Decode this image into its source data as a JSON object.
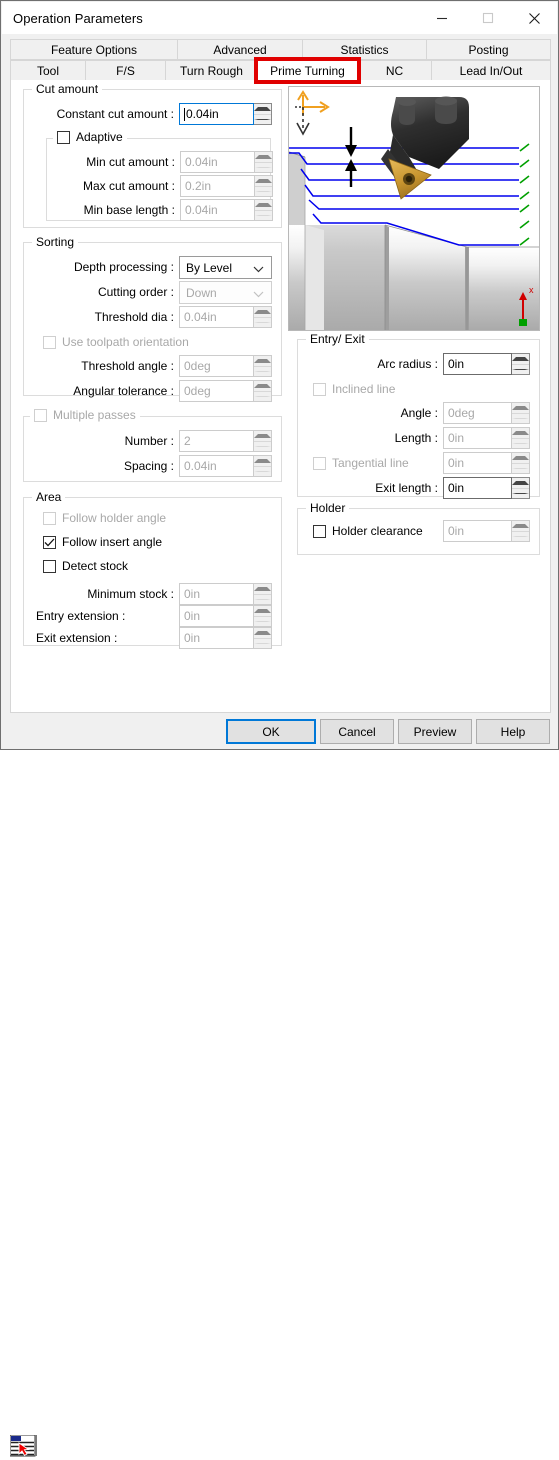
{
  "window": {
    "title": "Operation Parameters",
    "controls": {
      "minimize": "minimize-icon",
      "maximize": "maximize-icon",
      "close": "close-icon"
    }
  },
  "tabs": {
    "row1": [
      "Feature Options",
      "Advanced",
      "Statistics",
      "Posting"
    ],
    "row2": [
      "Tool",
      "F/S",
      "Turn Rough",
      "Prime Turning",
      "NC",
      "Lead In/Out"
    ],
    "active": "Prime Turning",
    "highlight_color": "#e00000"
  },
  "cut_amount": {
    "title": "Cut amount",
    "constant_cut_amount_label": "Constant cut amount :",
    "constant_cut_amount_value": "0.04in",
    "adaptive_label": "Adaptive",
    "adaptive_checked": false,
    "min_cut_amount_label": "Min cut amount :",
    "min_cut_amount_value": "0.04in",
    "max_cut_amount_label": "Max cut amount :",
    "max_cut_amount_value": "0.2in",
    "min_base_length_label": "Min base length :",
    "min_base_length_value": "0.04in"
  },
  "sorting": {
    "title": "Sorting",
    "depth_processing_label": "Depth processing :",
    "depth_processing_value": "By Level",
    "cutting_order_label": "Cutting order :",
    "cutting_order_value": "Down",
    "threshold_dia_label": "Threshold dia :",
    "threshold_dia_value": "0.04in",
    "use_toolpath_orientation_label": "Use toolpath orientation",
    "use_toolpath_orientation_checked": false,
    "threshold_angle_label": "Threshold angle :",
    "threshold_angle_value": "0deg",
    "angular_tolerance_label": "Angular tolerance :",
    "angular_tolerance_value": "0deg"
  },
  "multiple_passes": {
    "title": "Multiple passes",
    "checked": false,
    "number_label": "Number :",
    "number_value": "2",
    "spacing_label": "Spacing :",
    "spacing_value": "0.04in"
  },
  "area": {
    "title": "Area",
    "follow_holder_angle_label": "Follow holder angle",
    "follow_holder_angle_checked": false,
    "follow_insert_angle_label": "Follow insert angle",
    "follow_insert_angle_checked": true,
    "detect_stock_label": "Detect stock",
    "detect_stock_checked": false,
    "minimum_stock_label": "Minimum stock :",
    "minimum_stock_value": "0in",
    "entry_extension_label": "Entry extension :",
    "entry_extension_value": "0in",
    "exit_extension_label": "Exit extension :",
    "exit_extension_value": "0in"
  },
  "entry_exit": {
    "title": "Entry/ Exit",
    "arc_radius_label": "Arc radius :",
    "arc_radius_value": "0in",
    "inclined_line_label": "Inclined line",
    "inclined_line_checked": false,
    "angle_label": "Angle :",
    "angle_value": "0deg",
    "length_label": "Length :",
    "length_value": "0in",
    "tangential_line_label": "Tangential line",
    "tangential_line_checked": false,
    "tangential_line_value": "0in",
    "exit_length_label": "Exit length :",
    "exit_length_value": "0in"
  },
  "holder": {
    "title": "Holder",
    "holder_clearance_label": "Holder clearance",
    "holder_clearance_checked": false,
    "holder_clearance_value": "0in"
  },
  "preview_graphic": {
    "name": "toolpath-preview",
    "axis_indicator": "axis-triad-icon",
    "axis_label_x": "x",
    "toolpath_color": "#0000ee",
    "insert_color": "#d8a43c",
    "holder_color": "#3a3a3a"
  },
  "footer": {
    "ok_label": "OK",
    "cancel_label": "Cancel",
    "preview_label": "Preview",
    "help_label": "Help",
    "corner_icon": "list-cursor-icon"
  }
}
